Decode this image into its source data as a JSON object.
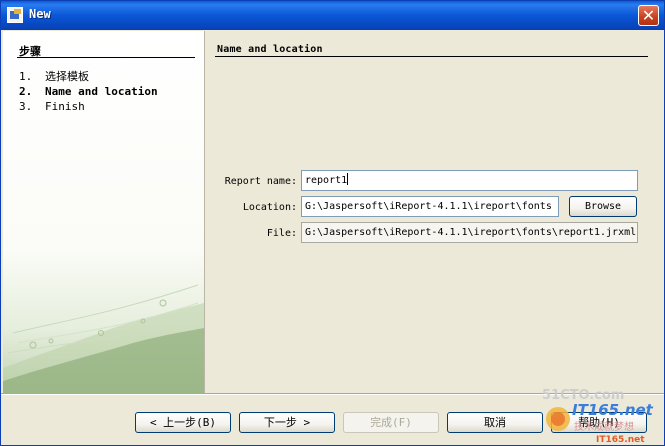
{
  "window": {
    "title": "New",
    "close_glyph": "✕"
  },
  "steps": {
    "heading": "步骤",
    "items": [
      {
        "num": "1.",
        "label": "选择模板"
      },
      {
        "num": "2.",
        "label": "Name and location"
      },
      {
        "num": "3.",
        "label": "Finish"
      }
    ]
  },
  "panel": {
    "title": "Name and location",
    "report_name_label": "Report name:",
    "report_name_value": "report1",
    "location_label": "Location:",
    "location_value": "G:\\Jaspersoft\\iReport-4.1.1\\ireport\\fonts",
    "browse_label": "Browse",
    "file_label": "File:",
    "file_value": "G:\\Jaspersoft\\iReport-4.1.1\\ireport\\fonts\\report1.jrxml"
  },
  "buttons": {
    "back": "< 上一步(B)",
    "next": "下一步 >",
    "finish": "完成(F)",
    "cancel": "取消",
    "help": "帮助(H)"
  },
  "watermark": {
    "site1": "51CTO.com",
    "site2": "IT165.net",
    "slogan": "技术成就梦想",
    "brand": "IT165.net"
  },
  "colors": {
    "titlebar": "#0a57d5",
    "dialog_bg": "#ece9d8",
    "field_border": "#7f9db9"
  }
}
